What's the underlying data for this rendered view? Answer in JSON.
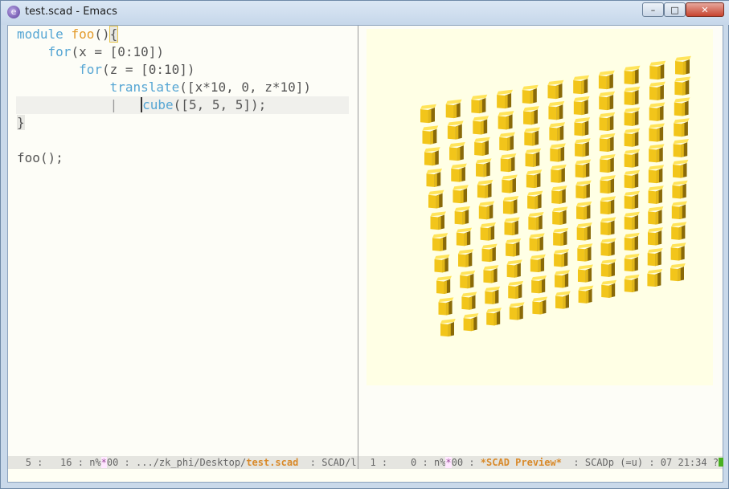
{
  "window": {
    "title": "test.scad - Emacs",
    "app_icon_glyph": "e",
    "buttons": {
      "minimize": "–",
      "maximize": "□",
      "close": "✕"
    }
  },
  "editor": {
    "lines": [
      [
        "module ",
        "foo",
        "(",
        ")",
        "{"
      ],
      [
        "    ",
        "for",
        "(x = [0:10])"
      ],
      [
        "        ",
        "for",
        "(z = [0:10])"
      ],
      [
        "            ",
        "translate",
        "([x*10, 0, z*10])"
      ],
      [
        "            ",
        "|",
        "   ",
        "cube",
        "([5, 5, 5]);"
      ],
      [
        "}"
      ],
      [
        ""
      ],
      [
        "foo();"
      ]
    ]
  },
  "modeline_left": {
    "line": "5",
    "col": "16",
    "flags_prefix": "n%",
    "flags_star": "*",
    "flags_suffix": "00",
    "path": ".../zk_phi/Desktop/",
    "buffer": "test.scad",
    "mode": "SCAD/l"
  },
  "modeline_right": {
    "line": "1",
    "col": "0",
    "flags_prefix": "n%",
    "flags_star": "*",
    "flags_suffix": "00",
    "buffer": "*SCAD Preview*",
    "mode": "SCADp (=u)",
    "date": "07",
    "time": "21:34",
    "trail": "?"
  },
  "preview": {
    "grid_cols": 11,
    "grid_rows": 11,
    "colors": {
      "background": "#ffffe5",
      "cube_front": "#f2c51a",
      "cube_top": "#ffe45a",
      "cube_side": "#8a6a08"
    }
  }
}
